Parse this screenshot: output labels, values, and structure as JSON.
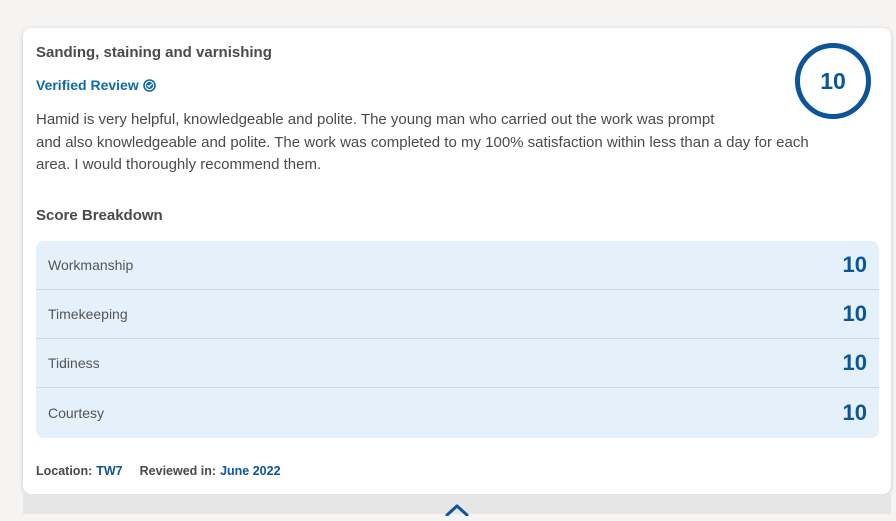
{
  "review": {
    "title": "Sanding, staining and varnishing",
    "verified_label": "Verified Review",
    "overall_score": "10",
    "text_lines": [
      "Hamid is very helpful, knowledgeable and polite. The young man who carried out the work was prompt",
      "and also knowledgeable and polite. The work was completed to my 100% satisfaction within less than a day for each",
      "area. I would thoroughly recommend them."
    ]
  },
  "breakdown": {
    "heading": "Score Breakdown",
    "rows": [
      {
        "label": "Workmanship",
        "score": "10"
      },
      {
        "label": "Timekeeping",
        "score": "10"
      },
      {
        "label": "Tidiness",
        "score": "10"
      },
      {
        "label": "Courtesy",
        "score": "10"
      }
    ]
  },
  "meta": {
    "location_label": "Location:",
    "location_value": "TW7",
    "reviewed_label": "Reviewed in:",
    "reviewed_value": "June 2022"
  },
  "icons": {
    "verified": "check-badge-icon",
    "expand": "chevron-up-icon"
  },
  "colors": {
    "accent": "#0b5598",
    "breakdown_bg": "#e4f0fa",
    "text": "#4a4a4a"
  }
}
